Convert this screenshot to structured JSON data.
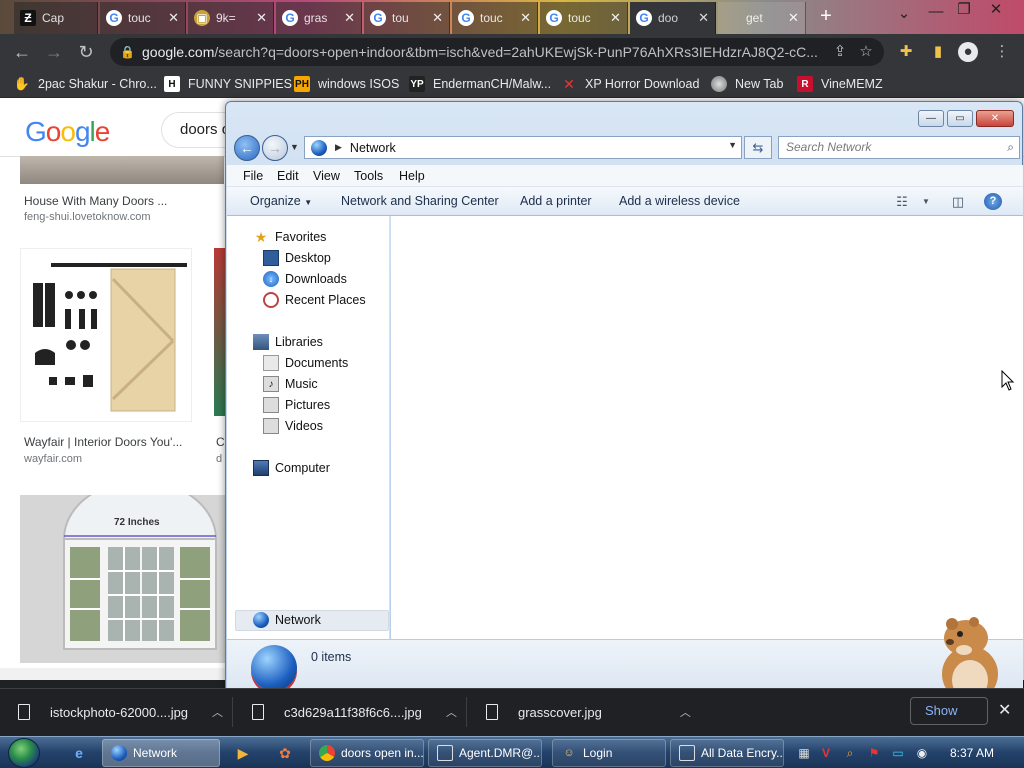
{
  "chrome": {
    "tabs": [
      {
        "title": "Cap",
        "icon": "letter-z-icon"
      },
      {
        "title": "touc",
        "icon": "google-g-icon"
      },
      {
        "title": "9k=",
        "icon": "image-icon"
      },
      {
        "title": "gras",
        "icon": "google-g-icon"
      },
      {
        "title": "tou",
        "icon": "google-g-icon"
      },
      {
        "title": "touc",
        "icon": "google-g-icon"
      },
      {
        "title": "touc",
        "icon": "google-g-icon"
      },
      {
        "title": "doo",
        "icon": "google-g-icon"
      },
      {
        "title": "get",
        "icon": "google-g-icon"
      }
    ],
    "url_host": "google.com",
    "url_path": "/search?q=doors+open+indoor&tbm=isch&ved=2ahUKEwjSk-PunP76AhXRs3IEHdzrAJ8Q2-cC...",
    "bookmarks": [
      {
        "label": "2pac Shakur - Chro...",
        "icon": "hand-icon"
      },
      {
        "label": "FUNNY SNIPPIES",
        "icon": "letter-h-icon"
      },
      {
        "label": "windows ISOS",
        "icon": "ph-icon"
      },
      {
        "label": "EndermanCH/Malw...",
        "icon": "yp-icon"
      },
      {
        "label": "XP Horror Download",
        "icon": "red-x-icon"
      },
      {
        "label": "New Tab",
        "icon": "globe-icon"
      },
      {
        "label": "VineMEMZ",
        "icon": "letter-r-icon"
      }
    ]
  },
  "google": {
    "logo": "Google",
    "query": "doors o",
    "results": [
      {
        "caption": "House With Many Doors ...",
        "source": "feng-shui.lovetoknow.com"
      },
      {
        "caption": "Wayfair | Interior Doors You'...",
        "source": "wayfair.com"
      },
      {
        "caption": "C",
        "source": "d"
      }
    ],
    "door_label": "72 Inches"
  },
  "explorer": {
    "caption_buttons": {
      "minimize": "—",
      "maximize": "▭",
      "close": "✕"
    },
    "address": "Network",
    "search_placeholder": "Search Network",
    "menu": [
      "File",
      "Edit",
      "View",
      "Tools",
      "Help"
    ],
    "commands": [
      "Organize",
      "Network and Sharing Center",
      "Add a printer",
      "Add a wireless device"
    ],
    "nav": {
      "favorites": "Favorites",
      "desktop": "Desktop",
      "downloads": "Downloads",
      "recent": "Recent Places",
      "libraries": "Libraries",
      "documents": "Documents",
      "music": "Music",
      "pictures": "Pictures",
      "videos": "Videos",
      "computer": "Computer",
      "network": "Network"
    },
    "item_count": "0 items"
  },
  "downloads": {
    "items": [
      "istockphoto-62000....jpg",
      "c3d629a11f38f6c6....jpg",
      "grasscover.jpg"
    ],
    "show_all": "Show"
  },
  "taskbar": {
    "items": [
      {
        "label": "Network",
        "icon": "network-icon"
      },
      {
        "label": "",
        "icon": "media-icon"
      },
      {
        "label": "doors open in...",
        "icon": "chrome-icon"
      },
      {
        "label": "Agent.DMR@...",
        "icon": "window-icon"
      },
      {
        "label": "Login",
        "icon": "user-icon"
      },
      {
        "label": "All Data Encry...",
        "icon": "window-icon"
      }
    ],
    "clock": "8:37 AM"
  }
}
